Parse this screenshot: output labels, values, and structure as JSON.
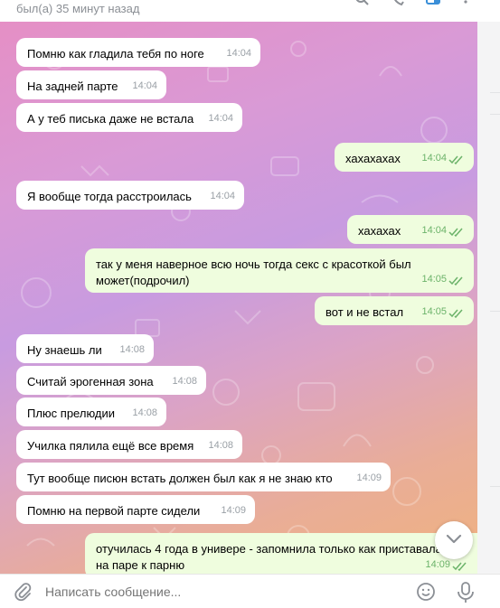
{
  "header": {
    "status_text": "был(а) 35 минут назад"
  },
  "messages": [
    {
      "text": "Помню как гладила тебя по ноге",
      "time": "14:04",
      "dir": "in"
    },
    {
      "text": "На задней парте",
      "time": "14:04",
      "dir": "in"
    },
    {
      "text": "А у теб писька даже не встала",
      "time": "14:04",
      "dir": "in"
    },
    {
      "text": "хахахахах",
      "time": "14:04",
      "dir": "out"
    },
    {
      "text": "Я вообще тогда расстроилась",
      "time": "14:04",
      "dir": "in"
    },
    {
      "text": "хахахах",
      "time": "14:04",
      "dir": "out"
    },
    {
      "line1": "так у меня наверное всю ночь тогда секс с красоткой был",
      "line2": "может(подрочил)",
      "time": "14:05",
      "dir": "out"
    },
    {
      "text": "вот и не встал",
      "time": "14:05",
      "dir": "out"
    },
    {
      "text": "Ну знаешь ли",
      "time": "14:08",
      "dir": "in"
    },
    {
      "text": "Считай эрогенная зона",
      "time": "14:08",
      "dir": "in"
    },
    {
      "text": "Плюс прелюдии",
      "time": "14:08",
      "dir": "in"
    },
    {
      "text": "Училка пялила ещё все время",
      "time": "14:08",
      "dir": "in"
    },
    {
      "text": "Тут вообще писюн встать должен был как я не знаю кто",
      "time": "14:09",
      "dir": "in"
    },
    {
      "text": "Помню на первой парте сидели",
      "time": "14:09",
      "dir": "in"
    },
    {
      "line1": "отучилась 4 года в универе - запомнила только как приставала",
      "line2": "на паре к парню",
      "time": "14:09",
      "dir": "out"
    }
  ],
  "composer": {
    "placeholder": "Написать сообщение..."
  },
  "icons": [
    "search-icon",
    "phone-icon",
    "sidebar-toggle-icon",
    "more-icon",
    "double-check-icon",
    "chevron-down-icon",
    "paperclip-icon",
    "emoji-icon",
    "microphone-icon"
  ],
  "colors": {
    "bubble_in": "#ffffff",
    "bubble_out": "#effdde",
    "check_color": "#6cb36a",
    "accent": "#3a8fd8"
  }
}
